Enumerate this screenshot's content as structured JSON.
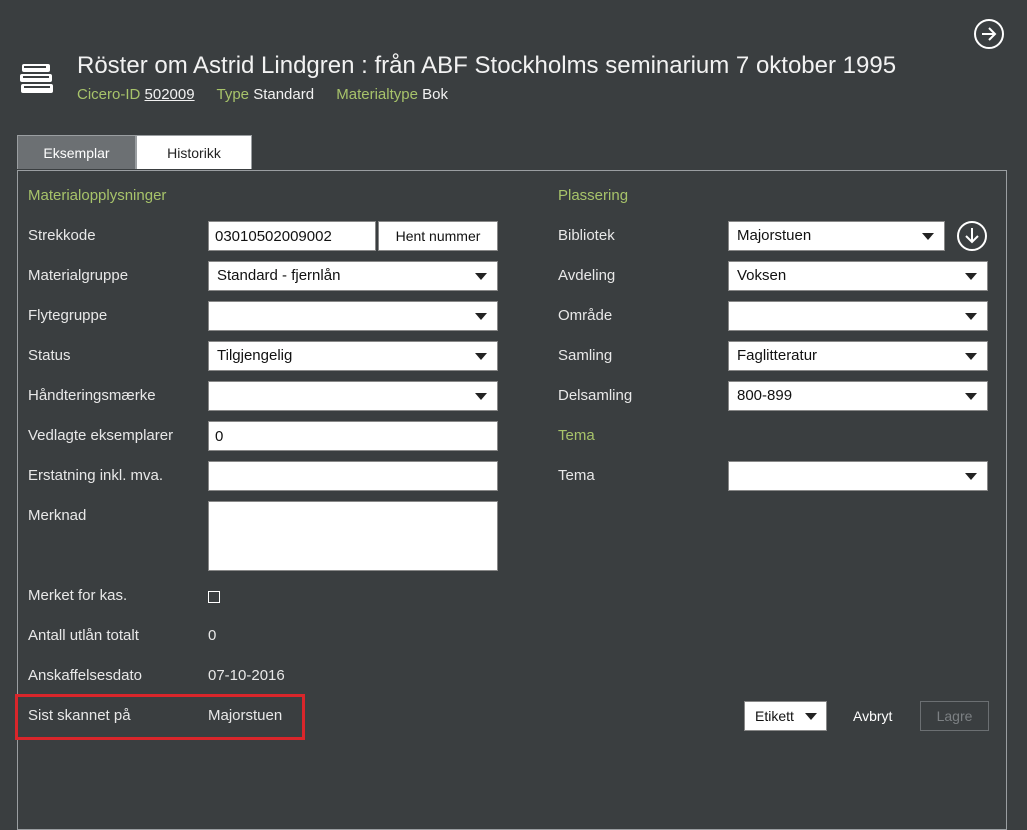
{
  "header": {
    "title": "Röster om Astrid Lindgren : från ABF Stockholms seminarium 7 oktober 1995",
    "cicero_label": "Cicero-ID",
    "cicero_value": "502009",
    "type_label": "Type",
    "type_value": "Standard",
    "materialtype_label": "Materialtype",
    "materialtype_value": "Bok"
  },
  "tabs": {
    "eksemplar": "Eksemplar",
    "historikk": "Historikk"
  },
  "material": {
    "section_title": "Materialopplysninger",
    "strekkode_label": "Strekkode",
    "strekkode_value": "03010502009002",
    "hent_nummer": "Hent nummer",
    "materialgruppe_label": "Materialgruppe",
    "materialgruppe_value": "Standard - fjernlån",
    "flytegruppe_label": "Flytegruppe",
    "flytegruppe_value": "",
    "status_label": "Status",
    "status_value": "Tilgjengelig",
    "handtering_label": "Håndteringsmærke",
    "handtering_value": "",
    "vedlagte_label": "Vedlagte eksemplarer",
    "vedlagte_value": "0",
    "erstatning_label": "Erstatning inkl. mva.",
    "erstatning_value": "",
    "merknad_label": "Merknad",
    "merknad_value": "",
    "merket_label": "Merket for kas.",
    "antall_label": "Antall utlån totalt",
    "antall_value": "0",
    "anskaffelse_label": "Anskaffelsesdato",
    "anskaffelse_value": "07-10-2016",
    "sist_label": "Sist skannet på",
    "sist_value": "Majorstuen"
  },
  "plassering": {
    "section_title": "Plassering",
    "bibliotek_label": "Bibliotek",
    "bibliotek_value": "Majorstuen",
    "avdeling_label": "Avdeling",
    "avdeling_value": "Voksen",
    "omrade_label": "Område",
    "omrade_value": "",
    "samling_label": "Samling",
    "samling_value": "Faglitteratur",
    "delsamling_label": "Delsamling",
    "delsamling_value": "800-899"
  },
  "tema": {
    "section_title": "Tema",
    "tema_label": "Tema",
    "tema_value": ""
  },
  "actions": {
    "etikett": "Etikett",
    "avbryt": "Avbryt",
    "lagre": "Lagre"
  },
  "colors": {
    "background": "#3a3e40",
    "accent_green": "#a7c36a",
    "highlight_red": "#d9262b"
  },
  "icons": {
    "exit": "arrow-right-circle-icon",
    "books": "book-stack-icon",
    "download": "arrow-down-circle-icon",
    "dropdown": "chevron-down-icon"
  }
}
